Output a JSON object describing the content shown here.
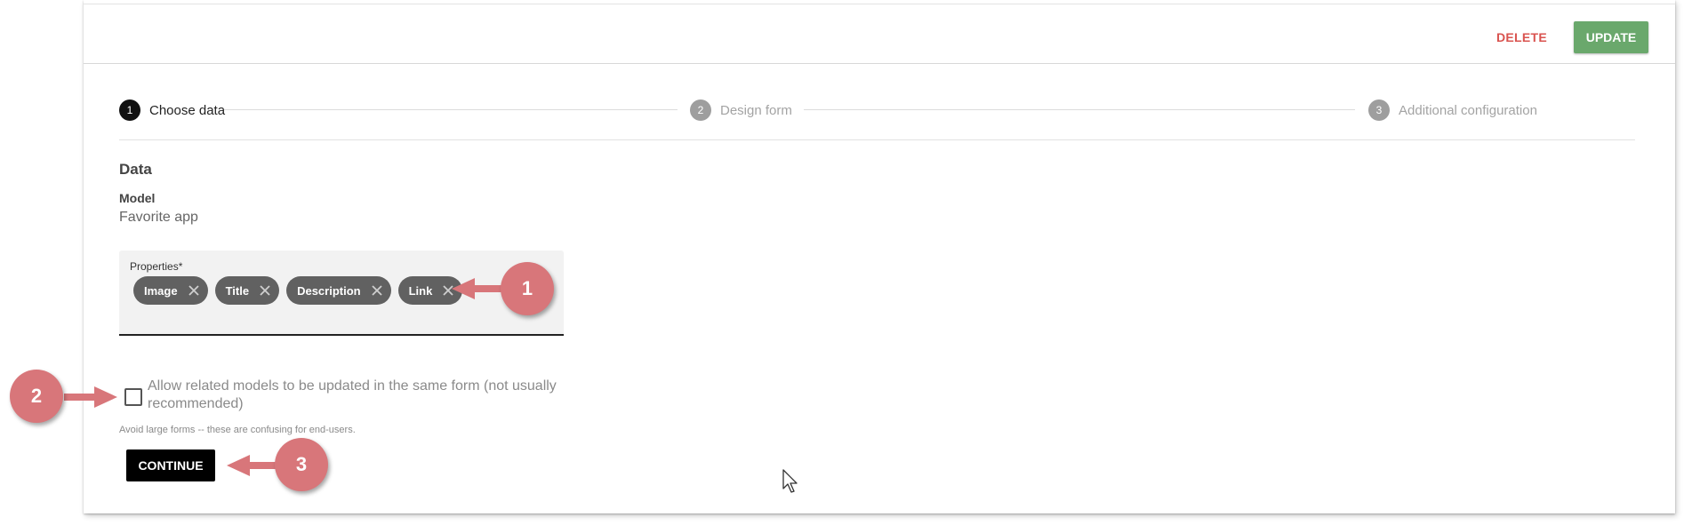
{
  "toolbar": {
    "delete_label": "DELETE",
    "update_label": "UPDATE"
  },
  "stepper": {
    "steps": [
      {
        "number": "1",
        "label": "Choose data",
        "state": "active"
      },
      {
        "number": "2",
        "label": "Design form",
        "state": "inactive"
      },
      {
        "number": "3",
        "label": "Additional configuration",
        "state": "inactive"
      }
    ]
  },
  "data_section": {
    "title": "Data",
    "model_label": "Model",
    "model_value": "Favorite app"
  },
  "properties": {
    "label": "Properties*",
    "chips": [
      {
        "label": "Image",
        "remove_icon": "close-icon"
      },
      {
        "label": "Title",
        "remove_icon": "close-icon"
      },
      {
        "label": "Description",
        "remove_icon": "close-icon"
      },
      {
        "label": "Link",
        "remove_icon": "close-icon"
      }
    ]
  },
  "related_models": {
    "checked": false,
    "label": "Allow related models to be updated in the same form (not usually recommended)",
    "hint": "Avoid large forms -- these are confusing for end-users."
  },
  "continue_label": "CONTINUE",
  "callouts": [
    "1",
    "2",
    "3"
  ],
  "colors": {
    "callout": "#d8767a",
    "update_button": "#6aa86c",
    "delete_text": "#d9534f",
    "active_step": "#111111",
    "chip": "#616161"
  }
}
